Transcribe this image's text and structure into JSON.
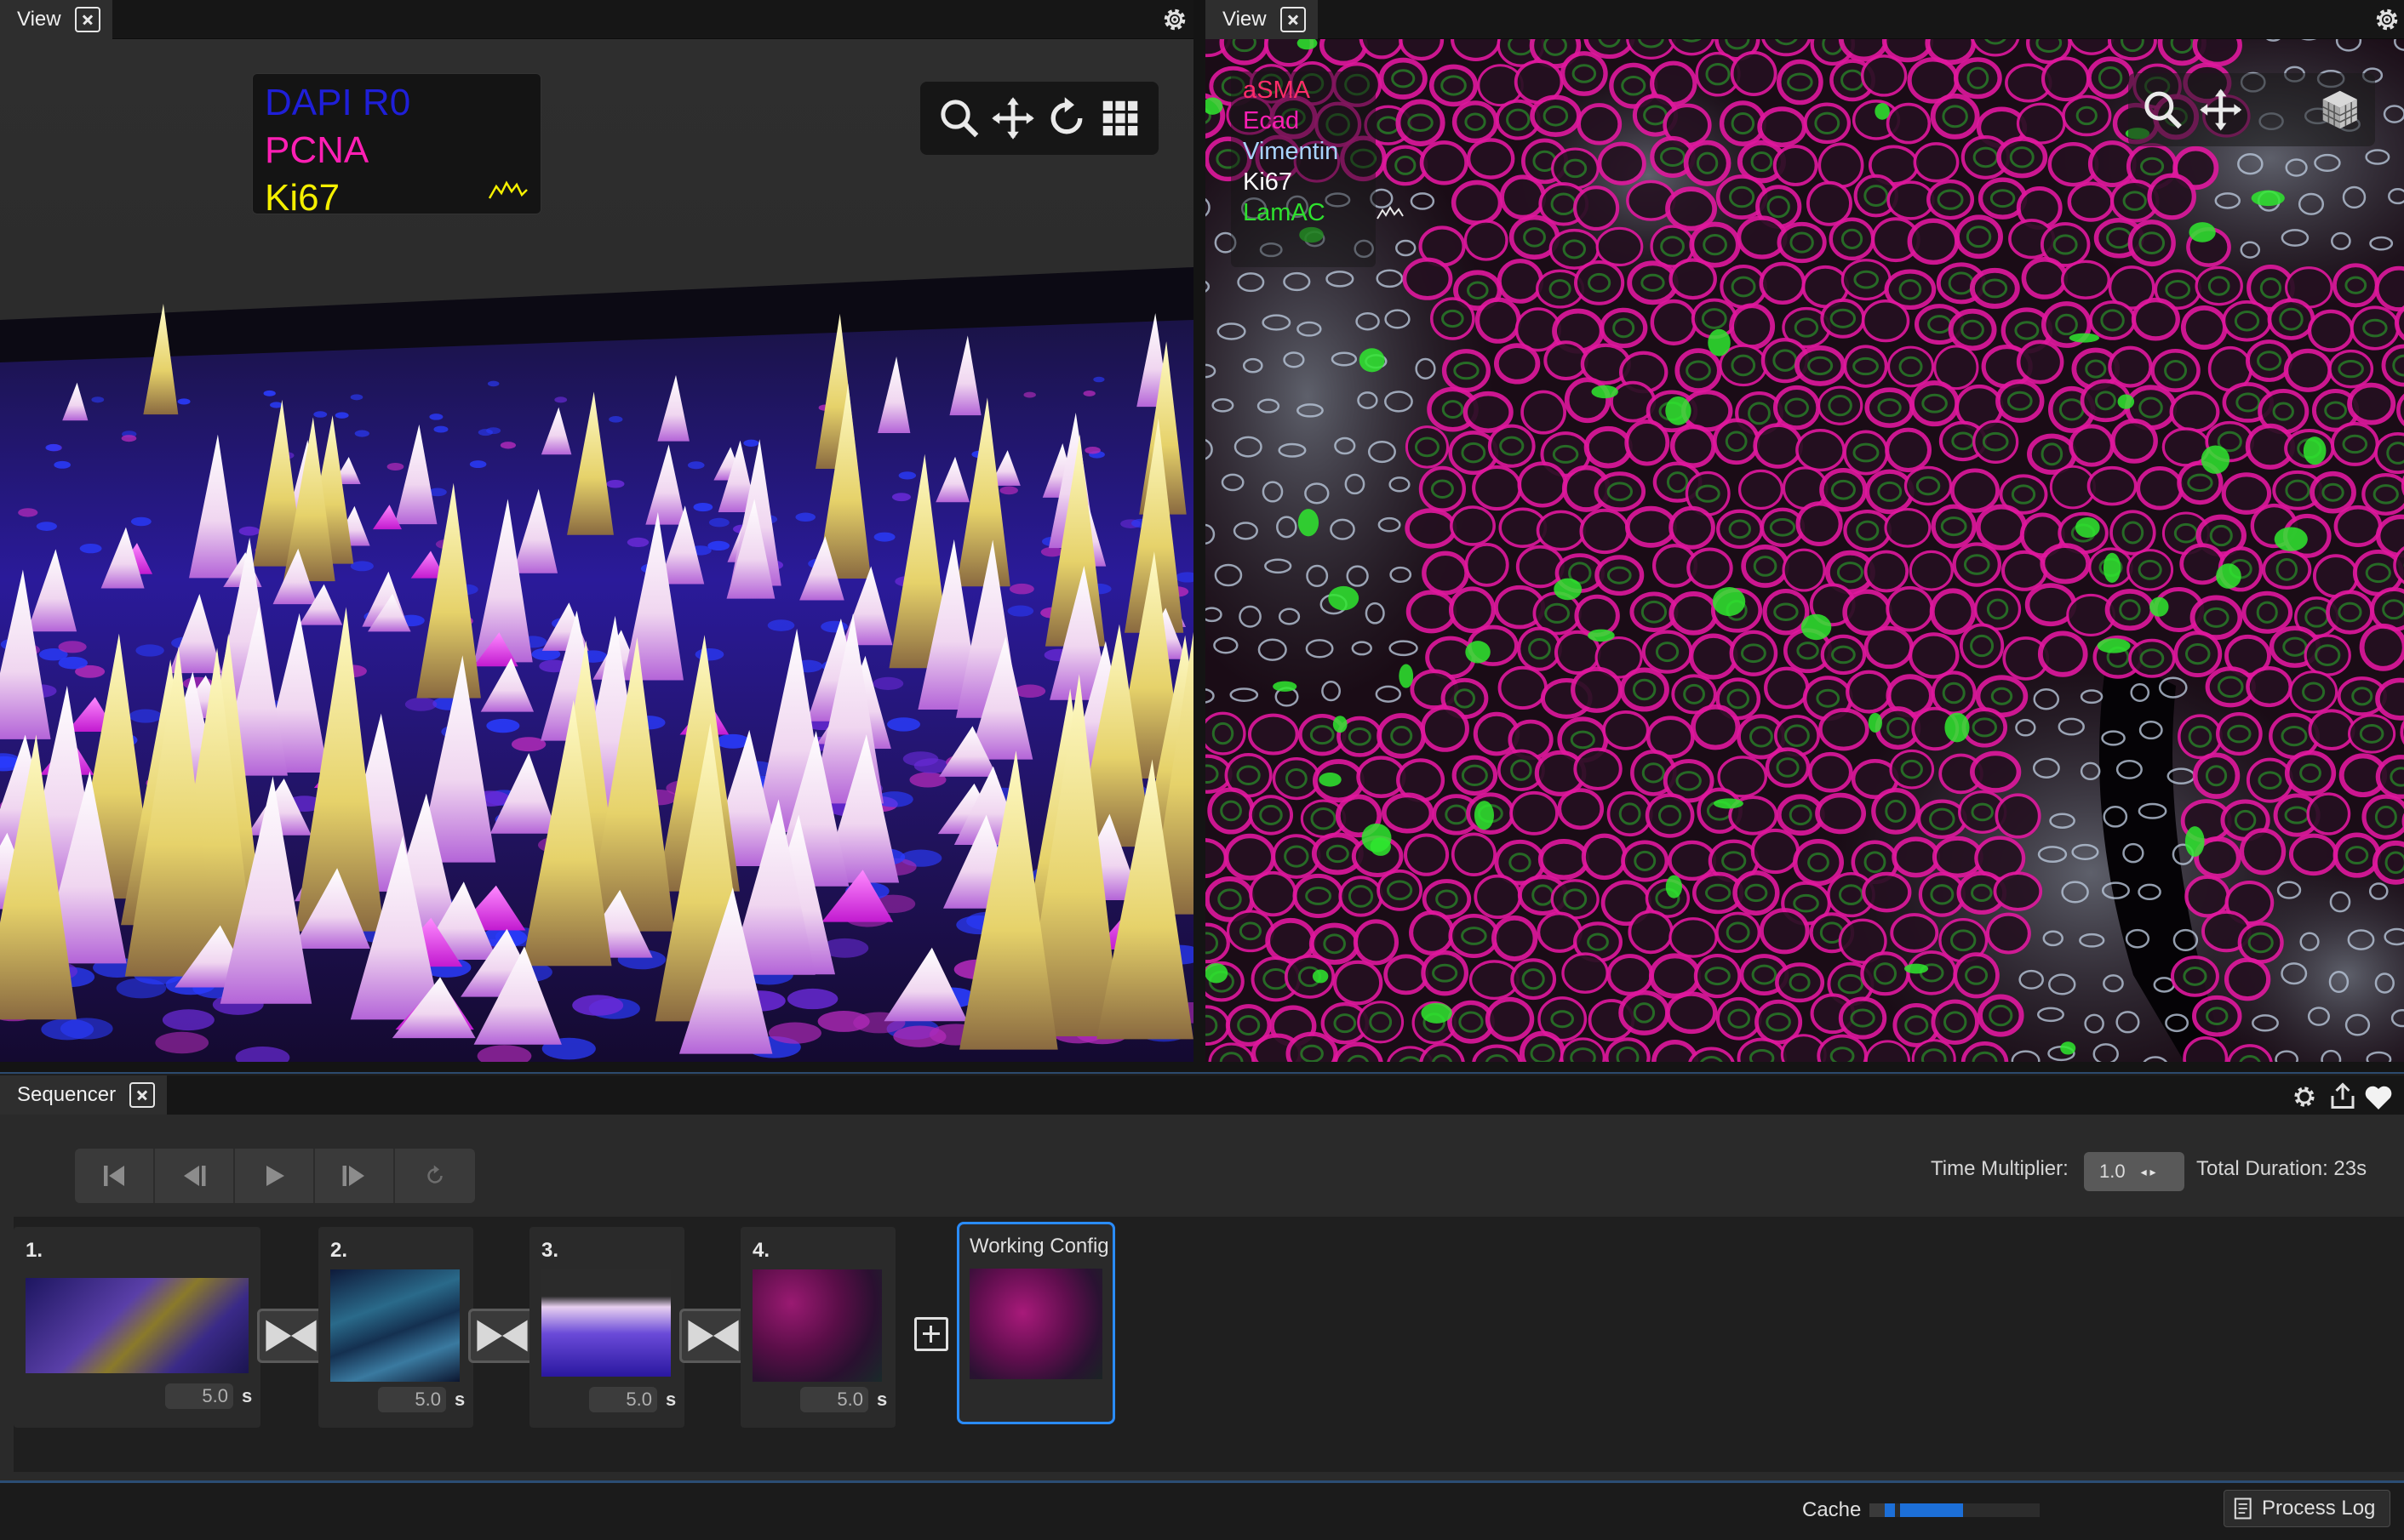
{
  "left_view": {
    "tab_label": "View",
    "legend": [
      {
        "label": "DAPI R0",
        "color": "#1f1fd8"
      },
      {
        "label": "PCNA",
        "color": "#ff1fb4"
      },
      {
        "label": "Ki67",
        "color": "#f5f000"
      }
    ],
    "toolbar": [
      "search-icon",
      "move-icon",
      "rotate-icon",
      "grid-icon"
    ]
  },
  "right_view": {
    "tab_label": "View",
    "legend": [
      {
        "label": "aSMA",
        "color": "#ff2d6b"
      },
      {
        "label": "Ecad",
        "color": "#ff1fb4"
      },
      {
        "label": "Vimentin",
        "color": "#a9d4ff"
      },
      {
        "label": "Ki67",
        "color": "#ffffff"
      },
      {
        "label": "LamAC",
        "color": "#2ee02e"
      }
    ],
    "toolbar": [
      "search-icon",
      "move-icon",
      "cube-icon"
    ]
  },
  "sequencer": {
    "tab_label": "Sequencer",
    "time_multiplier_label": "Time Multiplier:",
    "time_multiplier_value": "1.0",
    "total_duration": "Total Duration: 23s",
    "keyframes": [
      {
        "num": "1.",
        "duration": "5.0",
        "unit": "s"
      },
      {
        "num": "2.",
        "duration": "5.0",
        "unit": "s"
      },
      {
        "num": "3.",
        "duration": "5.0",
        "unit": "s"
      },
      {
        "num": "4.",
        "duration": "5.0",
        "unit": "s"
      }
    ],
    "working_config_label": "Working Config"
  },
  "status": {
    "cache_label": "Cache",
    "cache_fill": 0.55,
    "process_log_label": "Process Log"
  },
  "colors": {
    "accent": "#2a8cff"
  }
}
